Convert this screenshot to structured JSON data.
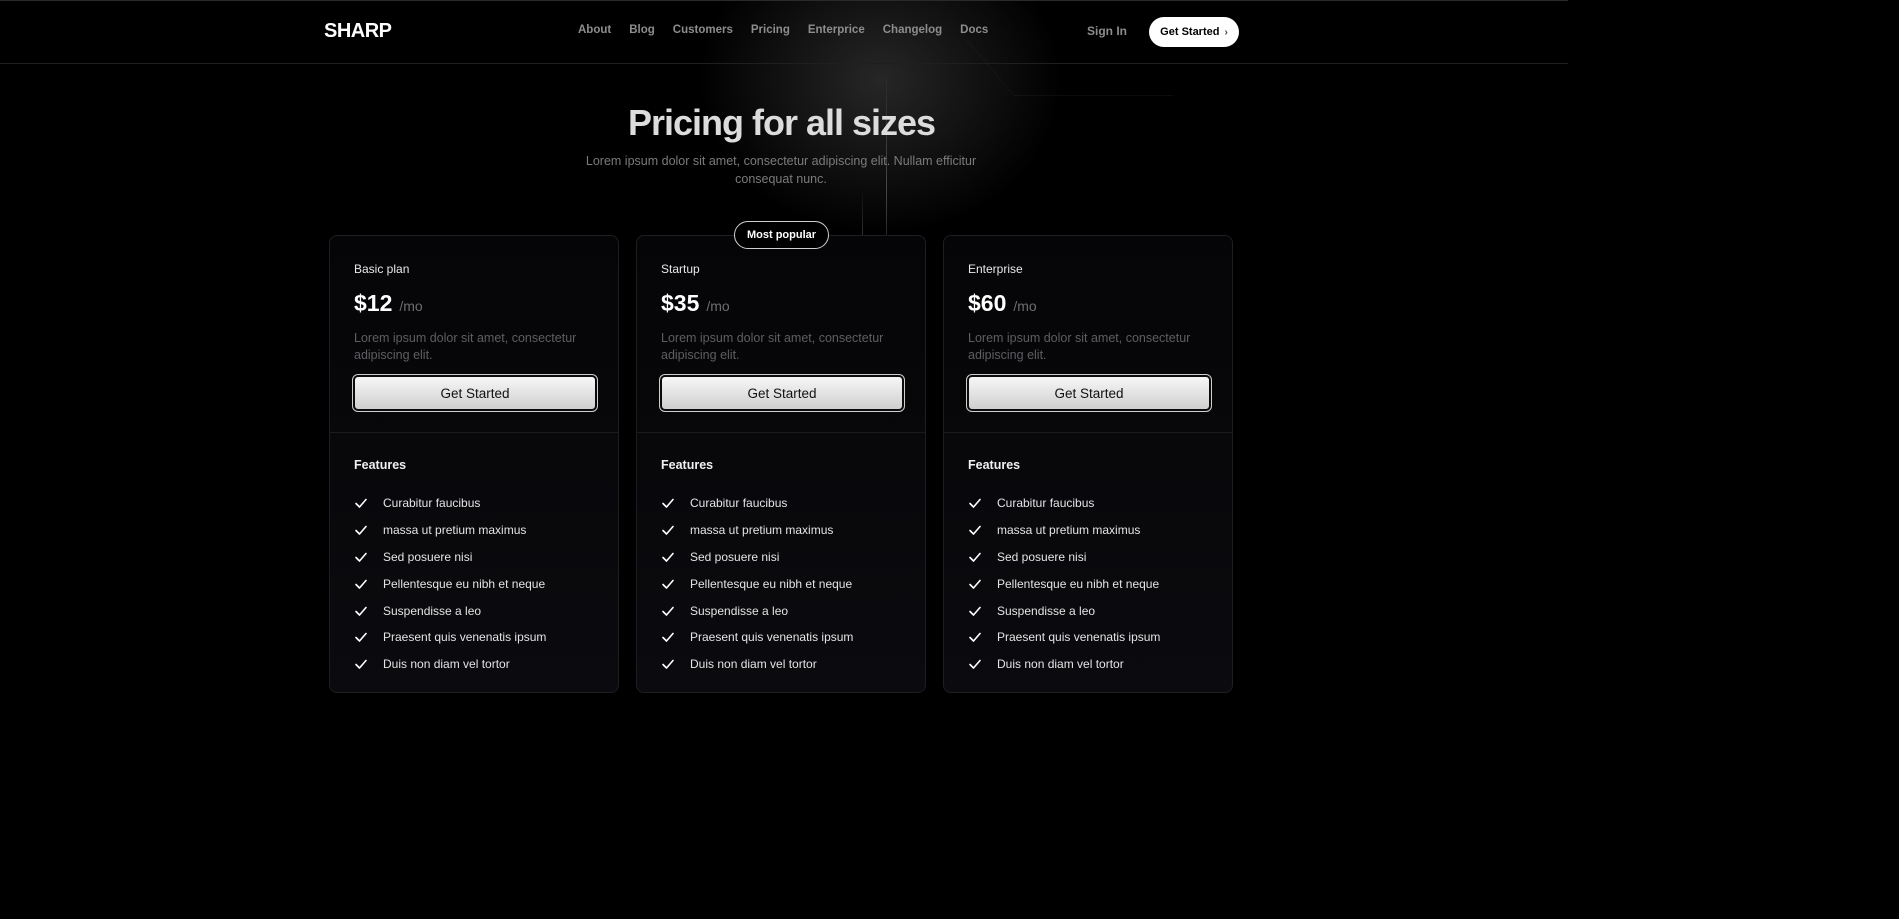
{
  "header": {
    "logo": "SHARP",
    "nav": [
      "About",
      "Blog",
      "Customers",
      "Pricing",
      "Enterprice",
      "Changelog",
      "Docs"
    ],
    "sign_in": "Sign In",
    "cta": "Get Started",
    "cta_icon": "chevron-right-icon"
  },
  "hero": {
    "title": "Pricing for all sizes",
    "subtitle": "Lorem ipsum dolor sit amet, consectetur adipiscing elit. Nullam efficitur consequat nunc."
  },
  "badge": "Most popular",
  "plans": [
    {
      "name": "Basic plan",
      "price": "$12",
      "period": "/mo",
      "description": "Lorem ipsum dolor sit amet, consectetur adipiscing elit.",
      "button": "Get Started",
      "features_title": "Features",
      "features": [
        "Curabitur faucibus",
        "massa ut pretium maximus",
        "Sed posuere nisi",
        "Pellentesque eu nibh et neque",
        "Suspendisse a leo",
        "Praesent quis venenatis ipsum",
        "Duis non diam vel tortor"
      ]
    },
    {
      "name": "Startup",
      "price": "$35",
      "period": "/mo",
      "description": "Lorem ipsum dolor sit amet, consectetur adipiscing elit.",
      "button": "Get Started",
      "features_title": "Features",
      "features": [
        "Curabitur faucibus",
        "massa ut pretium maximus",
        "Sed posuere nisi",
        "Pellentesque eu nibh et neque",
        "Suspendisse a leo",
        "Praesent quis venenatis ipsum",
        "Duis non diam vel tortor"
      ]
    },
    {
      "name": "Enterprise",
      "price": "$60",
      "period": "/mo",
      "description": "Lorem ipsum dolor sit amet, consectetur adipiscing elit.",
      "button": "Get Started",
      "features_title": "Features",
      "features": [
        "Curabitur faucibus",
        "massa ut pretium maximus",
        "Sed posuere nisi",
        "Pellentesque eu nibh et neque",
        "Suspendisse a leo",
        "Praesent quis venenatis ipsum",
        "Duis non diam vel tortor"
      ]
    }
  ],
  "icons": {
    "feature_check": "check-icon"
  },
  "colors": {
    "background": "#000000",
    "accent": "#ffffff",
    "muted_text": "#7b7b7b"
  }
}
